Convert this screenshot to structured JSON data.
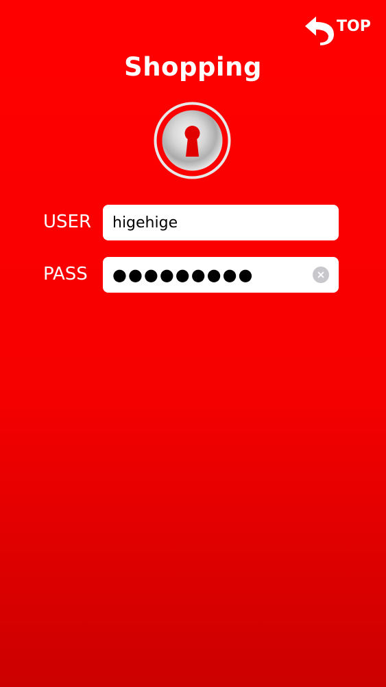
{
  "header": {
    "top_label": "TOP",
    "top_icon": "return-arrow-icon",
    "title": "Shopping"
  },
  "lock": {
    "icon": "keyhole-lock-icon"
  },
  "login": {
    "user_label": "USER",
    "user_value": "higehige",
    "pass_label": "PASS",
    "pass_masked": "●●●●●●●●●",
    "clear_icon": "clear-icon"
  },
  "colors": {
    "background": "#ff0000",
    "background_bottom": "#cc0000",
    "text": "#ffffff",
    "field_bg": "#ffffff",
    "clear_button": "#c7c7cc"
  }
}
